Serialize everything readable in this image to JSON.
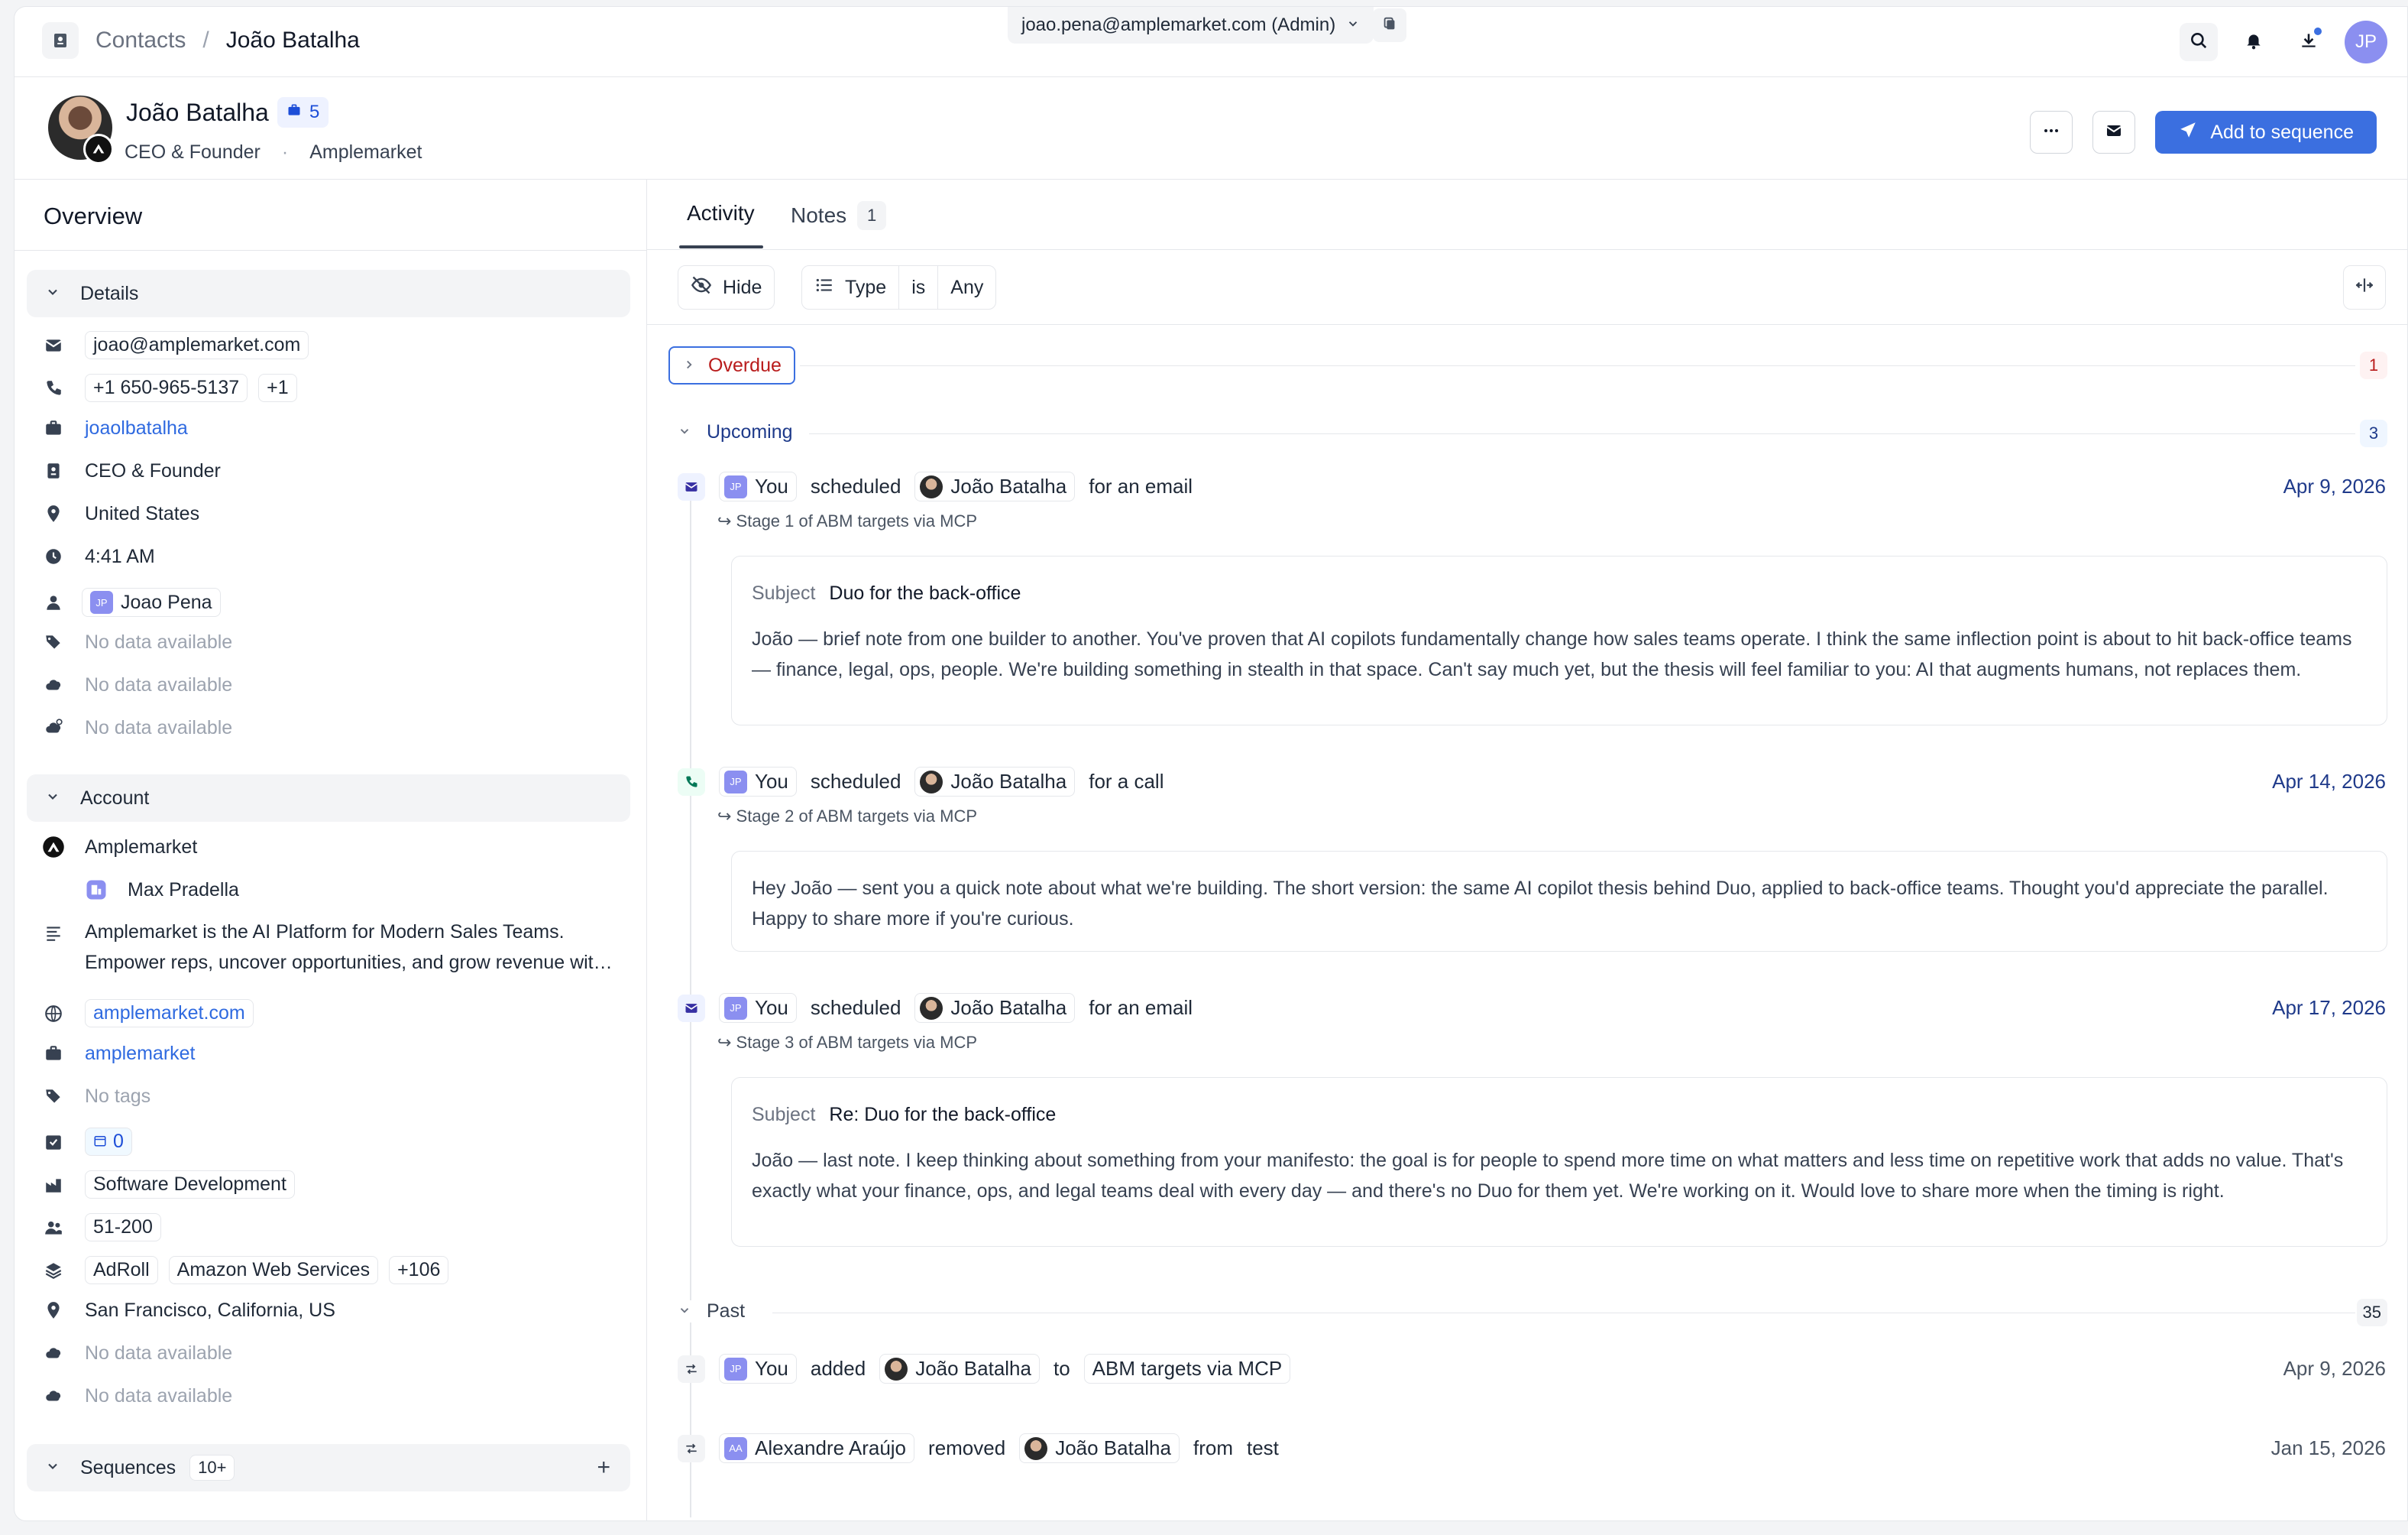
{
  "topbar": {
    "breadcrumb_parent": "Contacts",
    "breadcrumb_sep": "/",
    "breadcrumb_current": "João Batalha",
    "account": "joao.pena@amplemarket.com (Admin)",
    "user_initials": "JP"
  },
  "contact": {
    "name": "João Batalha",
    "badge_count": "5",
    "title": "CEO & Founder",
    "separator": "·",
    "company": "Amplemarket",
    "add_to_sequence": "Add to sequence"
  },
  "overview": {
    "title": "Overview",
    "details": {
      "label": "Details",
      "email": "joao@amplemarket.com",
      "phone": "+1 650-965-5137",
      "phone_more": "+1",
      "linkedin": "joaolbatalha",
      "job_title": "CEO & Founder",
      "location": "United States",
      "local_time": "4:41 AM",
      "owner_initials": "JP",
      "owner": "Joao Pena",
      "no_data_1": "No data available",
      "no_data_2": "No data available",
      "no_data_3": "No data available"
    },
    "account": {
      "label": "Account",
      "name": "Amplemarket",
      "owner": "Max Pradella",
      "description": "Amplemarket is the AI Platform for Modern Sales Teams. Empower reps, uncover opportunities, and grow revenue with AI-powered automation.",
      "website": "amplemarket.com",
      "linkedin": "amplemarket",
      "tags": "No tags",
      "tasks_count": "0",
      "industry": "Software Development",
      "size": "51-200",
      "tech_1": "AdRoll",
      "tech_2": "Amazon Web Services",
      "tech_more": "+106",
      "hq": "San Francisco, California, US",
      "no_data_1": "No data available",
      "no_data_2": "No data available"
    },
    "sequences": {
      "label": "Sequences",
      "count": "10+",
      "add": "+"
    }
  },
  "tabs": {
    "activity": "Activity",
    "notes": "Notes",
    "notes_count": "1"
  },
  "filters": {
    "hide": "Hide",
    "type": "Type",
    "op": "is",
    "value": "Any"
  },
  "groups": {
    "overdue": "Overdue",
    "overdue_count": "1",
    "upcoming": "Upcoming",
    "upcoming_count": "3",
    "past": "Past",
    "past_count": "35"
  },
  "upcoming": [
    {
      "actor_initials": "JP",
      "actor": "You",
      "verb": "scheduled",
      "target": "João Batalha",
      "suffix": "for an email",
      "date": "Apr 9, 2026",
      "stage": "↪ Stage 1 of ABM targets via MCP",
      "subject_label": "Subject",
      "subject": "Duo for the back-office",
      "body": "João — brief note from one builder to another. You've proven that AI copilots fundamentally change how sales teams operate. I think the same inflection point is about to hit back-office teams — finance, legal, ops, people. We're building something in stealth in that space. Can't say much yet, but the thesis will feel familiar to you: AI that augments humans, not replaces them."
    },
    {
      "actor_initials": "JP",
      "actor": "You",
      "verb": "scheduled",
      "target": "João Batalha",
      "suffix": "for a call",
      "date": "Apr 14, 2026",
      "stage": "↪ Stage 2 of ABM targets via MCP",
      "body": "Hey João — sent you a quick note about what we're building. The short version: the same AI copilot thesis behind Duo, applied to back-office teams. Thought you'd appreciate the parallel. Happy to share more if you're curious."
    },
    {
      "actor_initials": "JP",
      "actor": "You",
      "verb": "scheduled",
      "target": "João Batalha",
      "suffix": "for an email",
      "date": "Apr 17, 2026",
      "stage": "↪ Stage 3 of ABM targets via MCP",
      "subject_label": "Subject",
      "subject": "Re: Duo for the back-office",
      "body": "João — last note. I keep thinking about something from your manifesto: the goal is for people to spend more time on what matters and less time on repetitive work that adds no value. That's exactly what your finance, ops, and legal teams deal with every day — and there's no Duo for them yet. We're working on it. Would love to share more when the timing is right."
    }
  ],
  "past": [
    {
      "actor_initials": "JP",
      "actor": "You",
      "verb": "added",
      "target": "João Batalha",
      "prep": "to",
      "object": "ABM targets via MCP",
      "date": "Apr 9, 2026"
    },
    {
      "actor_initials": "AA",
      "actor": "Alexandre Araújo",
      "verb": "removed",
      "target": "João Batalha",
      "prep": "from",
      "object": "test",
      "date": "Jan 15, 2026"
    }
  ]
}
